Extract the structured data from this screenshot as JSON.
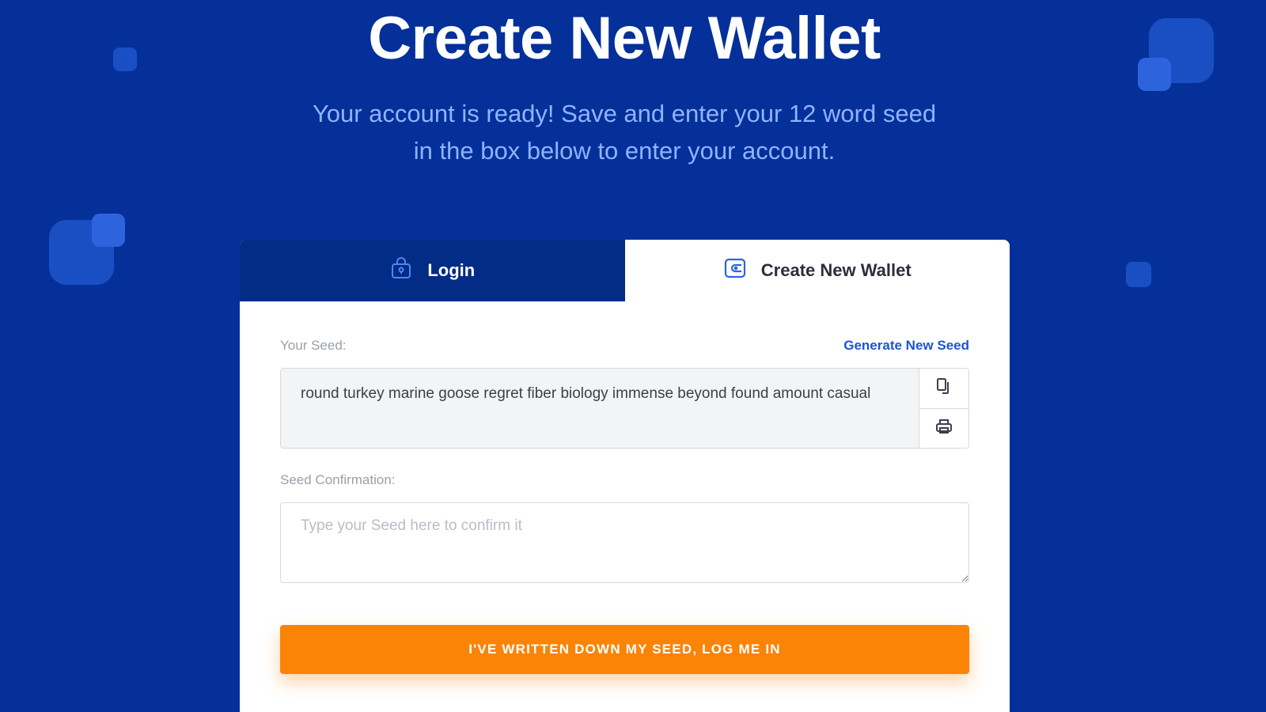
{
  "page": {
    "title": "Create New Wallet",
    "subtitle_line1": "Your account is ready! Save and enter your 12 word seed",
    "subtitle_line2": "in the box below to enter your account."
  },
  "tabs": {
    "login": {
      "label": "Login",
      "icon": "lock-bag-icon",
      "active": false
    },
    "create": {
      "label": "Create New Wallet",
      "icon": "wallet-icon",
      "active": true
    }
  },
  "seed": {
    "label": "Your Seed:",
    "generate_link": "Generate New Seed",
    "value": "round turkey marine goose regret fiber biology immense beyond found amount casual",
    "copy_icon": "copy-icon",
    "print_icon": "print-icon"
  },
  "confirmation": {
    "label": "Seed Confirmation:",
    "placeholder": "Type your Seed here to confirm it",
    "value": ""
  },
  "submit": {
    "label": "I'VE WRITTEN DOWN MY SEED, LOG ME IN"
  },
  "colors": {
    "background": "#05309a",
    "active_tab_dark": "#022c85",
    "accent_blue": "#1c55d2",
    "button_orange": "#fb8306",
    "subtitle": "#8fb3ff"
  }
}
